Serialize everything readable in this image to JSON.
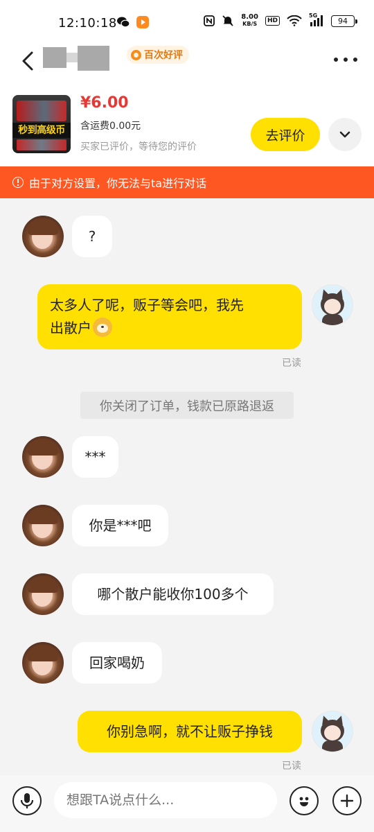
{
  "status_bar": {
    "time": "12:10:18",
    "net_speed_value": "8.00",
    "net_speed_unit": "KB/S",
    "hd_label": "HD",
    "signal_label": "5G",
    "battery": "94"
  },
  "header": {
    "badge_label": "百次好评",
    "badge_color": "#e17a0f"
  },
  "product": {
    "thumb_text": "秒到高级币",
    "price": "¥6.00",
    "shipping": "含运费0.00元",
    "review_state": "买家已评价，等待您的评价",
    "review_button": "去评价",
    "accent_color": "#ffe000",
    "price_color": "#e53935"
  },
  "notice": {
    "text": "由于对方设置，你无法与ta进行对话",
    "color": "#ff5722"
  },
  "messages": [
    {
      "side": "in",
      "text": "?"
    },
    {
      "side": "out",
      "text_line1": "太多人了呢，贩子等会吧，我先",
      "text_line2": "出散户",
      "emoji": "doge",
      "read": "已读"
    },
    {
      "side": "system",
      "text": "你关闭了订单，钱款已原路退返"
    },
    {
      "side": "in",
      "text": "***"
    },
    {
      "side": "in",
      "text": "你是***吧"
    },
    {
      "side": "in",
      "text": "哪个散户能收你100多个"
    },
    {
      "side": "in",
      "text": "回家喝奶"
    },
    {
      "side": "out",
      "text": "你别急啊，就不让贩子挣钱",
      "read": "已读"
    }
  ],
  "input": {
    "placeholder": "想跟TA说点什么..."
  }
}
